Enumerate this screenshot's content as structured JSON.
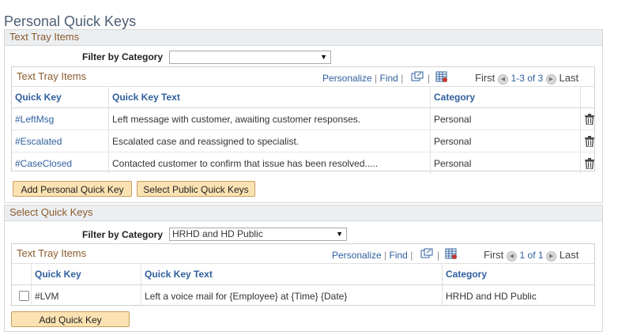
{
  "page_title": "Personal Quick Keys",
  "text_tray": {
    "section_title": "Text Tray Items",
    "filter_label": "Filter by Category",
    "filter_value": "",
    "grid": {
      "title": "Text Tray Items",
      "personalize": "Personalize",
      "find": "Find",
      "first": "First",
      "range": "1-3 of 3",
      "last": "Last",
      "headers": [
        "Quick Key",
        "Quick Key Text",
        "Category"
      ],
      "rows": [
        {
          "key": "#LeftMsg",
          "text": "Left message with customer, awaiting customer responses.",
          "category": "Personal"
        },
        {
          "key": "#Escalated",
          "text": "Escalated case and reassigned to specialist.",
          "category": "Personal"
        },
        {
          "key": "#CaseClosed",
          "text": "Contacted customer to confirm that issue has been resolved.....",
          "category": "Personal"
        }
      ]
    },
    "add_button": "Add Personal Quick Key",
    "select_public_button": "Select Public Quick Keys"
  },
  "select_keys": {
    "section_title": "Select Quick Keys",
    "filter_label": "Filter by Category",
    "filter_value": "HRHD and HD Public",
    "grid": {
      "title": "Text Tray Items",
      "personalize": "Personalize",
      "find": "Find",
      "first": "First",
      "range": "1 of 1",
      "last": "Last",
      "headers": [
        "Quick Key",
        "Quick Key Text",
        "Category"
      ],
      "rows": [
        {
          "key": "#LVM",
          "text": "Left a voice mail for {Employee} at {Time} {Date}",
          "category": "HRHD and HD Public",
          "checked": false
        }
      ]
    },
    "add_button": "Add Quick Key"
  },
  "icons": {
    "view_all": "new-window-icon",
    "download": "spreadsheet-download-icon",
    "prev": "previous-arrow-icon",
    "next": "next-arrow-icon",
    "delete": "trash-icon",
    "dropdown": "chevron-down-icon"
  }
}
